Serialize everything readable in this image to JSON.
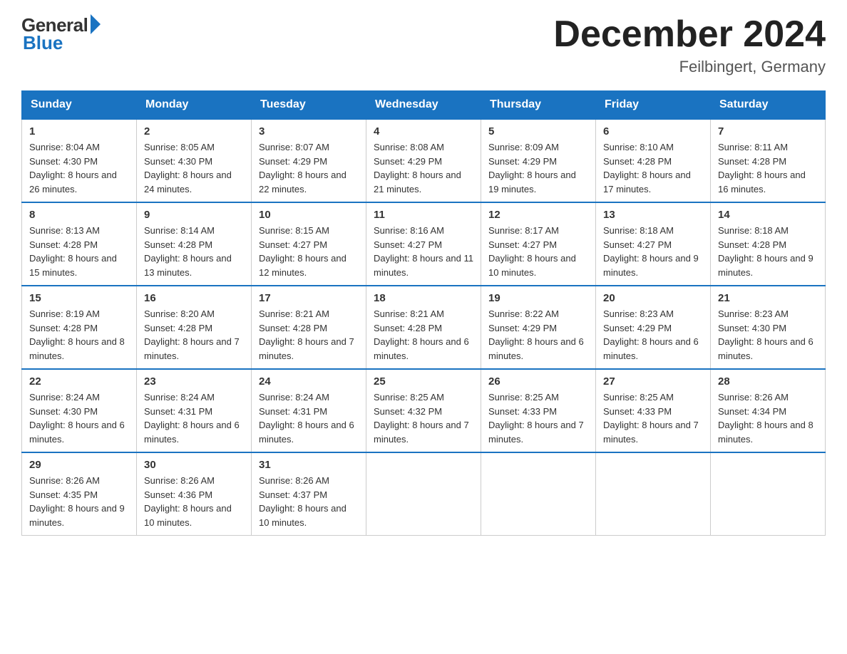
{
  "header": {
    "logo_general": "General",
    "logo_blue": "Blue",
    "month_title": "December 2024",
    "location": "Feilbingert, Germany"
  },
  "weekdays": [
    "Sunday",
    "Monday",
    "Tuesday",
    "Wednesday",
    "Thursday",
    "Friday",
    "Saturday"
  ],
  "weeks": [
    [
      {
        "day": "1",
        "sunrise": "8:04 AM",
        "sunset": "4:30 PM",
        "daylight": "8 hours and 26 minutes."
      },
      {
        "day": "2",
        "sunrise": "8:05 AM",
        "sunset": "4:30 PM",
        "daylight": "8 hours and 24 minutes."
      },
      {
        "day": "3",
        "sunrise": "8:07 AM",
        "sunset": "4:29 PM",
        "daylight": "8 hours and 22 minutes."
      },
      {
        "day": "4",
        "sunrise": "8:08 AM",
        "sunset": "4:29 PM",
        "daylight": "8 hours and 21 minutes."
      },
      {
        "day": "5",
        "sunrise": "8:09 AM",
        "sunset": "4:29 PM",
        "daylight": "8 hours and 19 minutes."
      },
      {
        "day": "6",
        "sunrise": "8:10 AM",
        "sunset": "4:28 PM",
        "daylight": "8 hours and 17 minutes."
      },
      {
        "day": "7",
        "sunrise": "8:11 AM",
        "sunset": "4:28 PM",
        "daylight": "8 hours and 16 minutes."
      }
    ],
    [
      {
        "day": "8",
        "sunrise": "8:13 AM",
        "sunset": "4:28 PM",
        "daylight": "8 hours and 15 minutes."
      },
      {
        "day": "9",
        "sunrise": "8:14 AM",
        "sunset": "4:28 PM",
        "daylight": "8 hours and 13 minutes."
      },
      {
        "day": "10",
        "sunrise": "8:15 AM",
        "sunset": "4:27 PM",
        "daylight": "8 hours and 12 minutes."
      },
      {
        "day": "11",
        "sunrise": "8:16 AM",
        "sunset": "4:27 PM",
        "daylight": "8 hours and 11 minutes."
      },
      {
        "day": "12",
        "sunrise": "8:17 AM",
        "sunset": "4:27 PM",
        "daylight": "8 hours and 10 minutes."
      },
      {
        "day": "13",
        "sunrise": "8:18 AM",
        "sunset": "4:27 PM",
        "daylight": "8 hours and 9 minutes."
      },
      {
        "day": "14",
        "sunrise": "8:18 AM",
        "sunset": "4:28 PM",
        "daylight": "8 hours and 9 minutes."
      }
    ],
    [
      {
        "day": "15",
        "sunrise": "8:19 AM",
        "sunset": "4:28 PM",
        "daylight": "8 hours and 8 minutes."
      },
      {
        "day": "16",
        "sunrise": "8:20 AM",
        "sunset": "4:28 PM",
        "daylight": "8 hours and 7 minutes."
      },
      {
        "day": "17",
        "sunrise": "8:21 AM",
        "sunset": "4:28 PM",
        "daylight": "8 hours and 7 minutes."
      },
      {
        "day": "18",
        "sunrise": "8:21 AM",
        "sunset": "4:28 PM",
        "daylight": "8 hours and 6 minutes."
      },
      {
        "day": "19",
        "sunrise": "8:22 AM",
        "sunset": "4:29 PM",
        "daylight": "8 hours and 6 minutes."
      },
      {
        "day": "20",
        "sunrise": "8:23 AM",
        "sunset": "4:29 PM",
        "daylight": "8 hours and 6 minutes."
      },
      {
        "day": "21",
        "sunrise": "8:23 AM",
        "sunset": "4:30 PM",
        "daylight": "8 hours and 6 minutes."
      }
    ],
    [
      {
        "day": "22",
        "sunrise": "8:24 AM",
        "sunset": "4:30 PM",
        "daylight": "8 hours and 6 minutes."
      },
      {
        "day": "23",
        "sunrise": "8:24 AM",
        "sunset": "4:31 PM",
        "daylight": "8 hours and 6 minutes."
      },
      {
        "day": "24",
        "sunrise": "8:24 AM",
        "sunset": "4:31 PM",
        "daylight": "8 hours and 6 minutes."
      },
      {
        "day": "25",
        "sunrise": "8:25 AM",
        "sunset": "4:32 PM",
        "daylight": "8 hours and 7 minutes."
      },
      {
        "day": "26",
        "sunrise": "8:25 AM",
        "sunset": "4:33 PM",
        "daylight": "8 hours and 7 minutes."
      },
      {
        "day": "27",
        "sunrise": "8:25 AM",
        "sunset": "4:33 PM",
        "daylight": "8 hours and 7 minutes."
      },
      {
        "day": "28",
        "sunrise": "8:26 AM",
        "sunset": "4:34 PM",
        "daylight": "8 hours and 8 minutes."
      }
    ],
    [
      {
        "day": "29",
        "sunrise": "8:26 AM",
        "sunset": "4:35 PM",
        "daylight": "8 hours and 9 minutes."
      },
      {
        "day": "30",
        "sunrise": "8:26 AM",
        "sunset": "4:36 PM",
        "daylight": "8 hours and 10 minutes."
      },
      {
        "day": "31",
        "sunrise": "8:26 AM",
        "sunset": "4:37 PM",
        "daylight": "8 hours and 10 minutes."
      },
      null,
      null,
      null,
      null
    ]
  ]
}
